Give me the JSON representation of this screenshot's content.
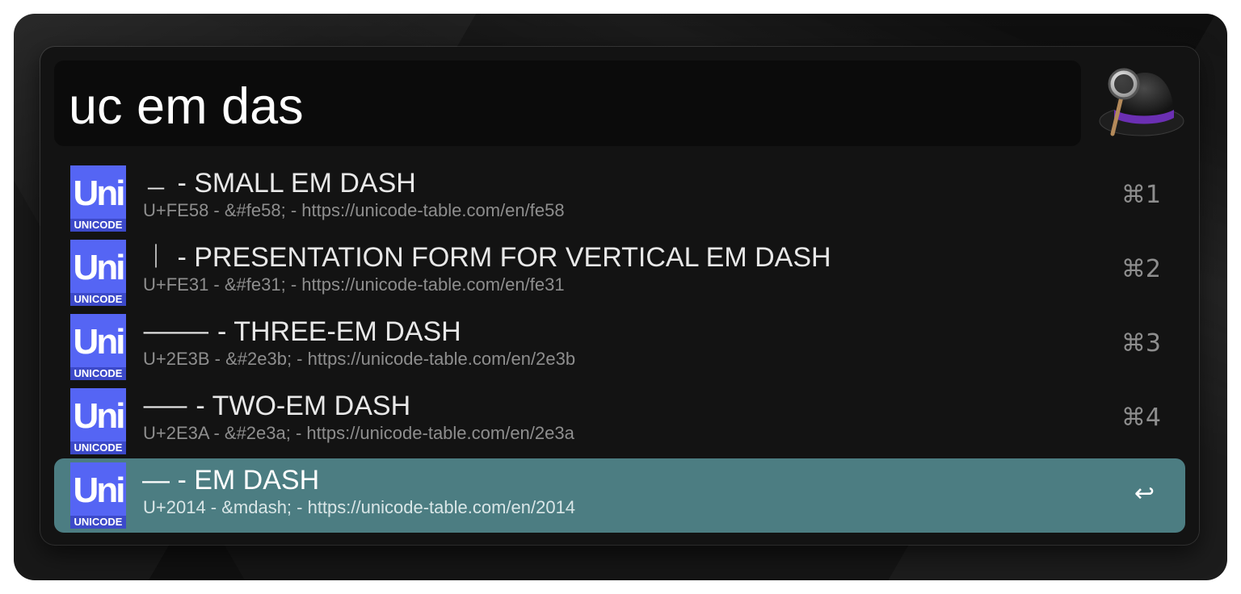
{
  "search": {
    "query": "uc em das"
  },
  "app": {
    "icon": "alfred-hat-icon"
  },
  "results": [
    {
      "title": " ﹘  - SMALL EM DASH",
      "subtitle": "U+FE58 - &#fe58; - https://unicode-table.com/en/fe58",
      "shortcut": "⌘1",
      "icon_label": "UNICODE",
      "selected": false
    },
    {
      "title": " ︱ - PRESENTATION FORM FOR VERTICAL EM DASH",
      "subtitle": "U+FE31 - &#fe31; - https://unicode-table.com/en/fe31",
      "shortcut": "⌘2",
      "icon_label": "UNICODE",
      "selected": false
    },
    {
      "title": "⸻ - THREE-EM DASH",
      "subtitle": "U+2E3B - &#2e3b; - https://unicode-table.com/en/2e3b",
      "shortcut": "⌘3",
      "icon_label": "UNICODE",
      "selected": false
    },
    {
      "title": "⸺ - TWO-EM DASH",
      "subtitle": "U+2E3A - &#2e3a; - https://unicode-table.com/en/2e3a",
      "shortcut": "⌘4",
      "icon_label": "UNICODE",
      "selected": false
    },
    {
      "title": "— - EM DASH",
      "subtitle": "U+2014 - &mdash; - https://unicode-table.com/en/2014",
      "shortcut": "↩",
      "icon_label": "UNICODE",
      "selected": true
    }
  ],
  "colors": {
    "selection": "#4c7d82",
    "unicode_icon": "#5565f4",
    "hat_band": "#6b2fb3"
  }
}
